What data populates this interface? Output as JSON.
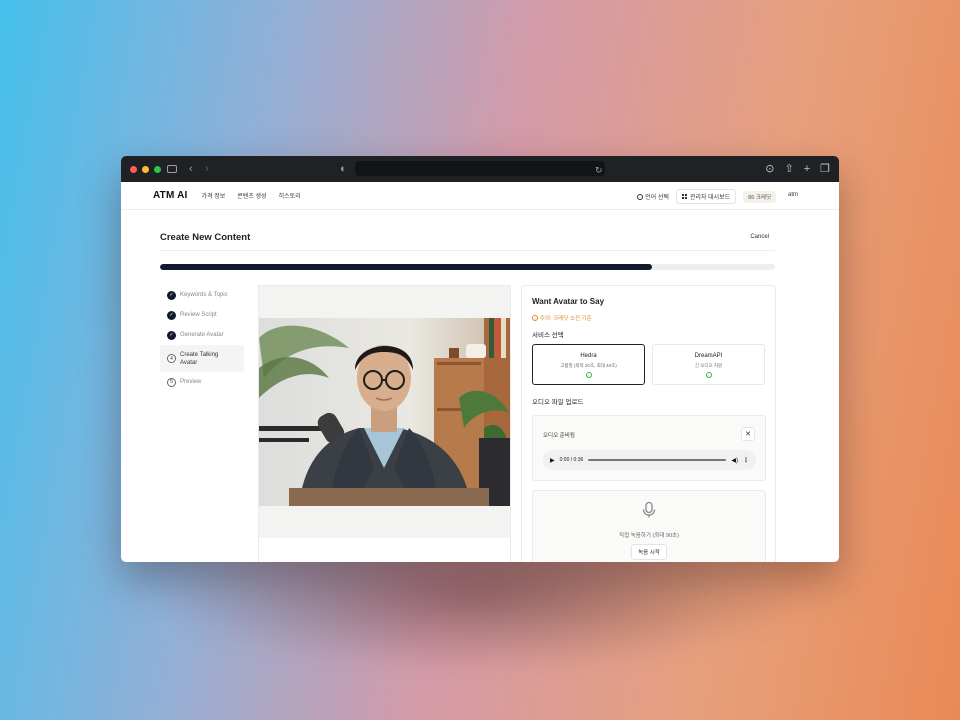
{
  "app": {
    "brand": "ATM AI",
    "nav": [
      "가격 정보",
      "콘텐츠 생성",
      "히스토리"
    ],
    "language_label": "언어 선택",
    "admin_label": "관리자 대시보드",
    "credits_label": "86 크레딧",
    "user_label": "atm"
  },
  "page": {
    "title": "Create New Content",
    "cancel_label": "Cancel",
    "progress": 0.8
  },
  "steps": [
    {
      "label": "Keywords & Topic",
      "state": "done"
    },
    {
      "label": "Review Script",
      "state": "done"
    },
    {
      "label": "Generate Avatar",
      "state": "done"
    },
    {
      "number": "4",
      "label": "Create Talking Avatar",
      "state": "active"
    },
    {
      "number": "5",
      "label": "Preview",
      "state": "pending"
    }
  ],
  "form": {
    "title": "Want Avatar to Say",
    "warning": "주의: 크레딧 소진 기준",
    "service_label": "서비스 선택",
    "services": [
      {
        "name": "Hedra",
        "desc": "고품질 (최적 20초, 최대 40초)",
        "selected": true
      },
      {
        "name": "DreamAPI",
        "desc": "긴 오디오 지원",
        "selected": false
      }
    ],
    "upload_label": "오디오 파일 업로드",
    "audio_ready": "오디오 준비됨",
    "close_glyph": "✕",
    "player": {
      "time": "0:00 / 0:36"
    },
    "record_label": "직접 녹음하기 (최대 90초)",
    "record_button": "녹음 시작"
  },
  "icons": {
    "accent": "#141a2e",
    "warning_color": "#e08a2a",
    "check_color": "#3aaf5c"
  }
}
